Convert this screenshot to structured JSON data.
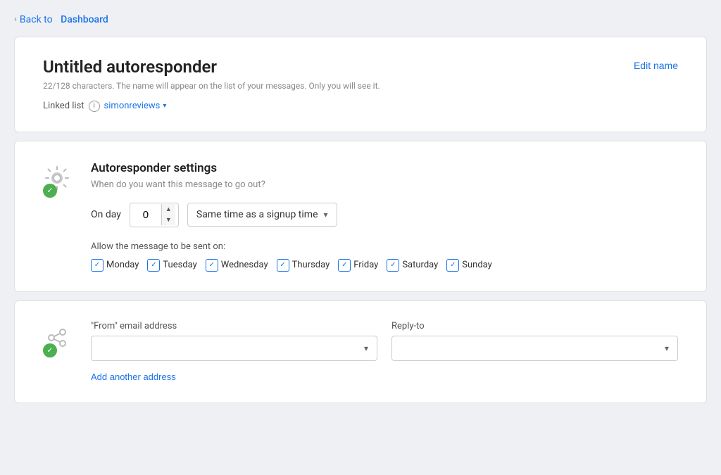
{
  "nav": {
    "chevron": "‹",
    "back_text": "Back to",
    "dashboard_text": "Dashboard"
  },
  "card1": {
    "title": "Untitled autoresponder",
    "char_count": "22/128 characters. The name will appear on the list of your messages. Only you will see it.",
    "linked_list_label": "Linked list",
    "linked_list_value": "simonreviews",
    "edit_name_label": "Edit name"
  },
  "card2": {
    "section_title": "Autoresponder settings",
    "section_subtitle": "When do you want this message to go out?",
    "day_label": "On day",
    "day_value": "0",
    "time_label": "Same time as a signup time",
    "allow_message_label": "Allow the message to be sent on:",
    "days": [
      {
        "name": "Monday",
        "checked": true
      },
      {
        "name": "Tuesday",
        "checked": true
      },
      {
        "name": "Wednesday",
        "checked": true
      },
      {
        "name": "Thursday",
        "checked": true
      },
      {
        "name": "Friday",
        "checked": true
      },
      {
        "name": "Saturday",
        "checked": true
      },
      {
        "name": "Sunday",
        "checked": true
      }
    ]
  },
  "card3": {
    "from_label": "\"From\" email address",
    "reply_to_label": "Reply-to",
    "add_address_label": "Add another address",
    "from_placeholder": "",
    "reply_placeholder": ""
  },
  "icons": {
    "gear": "⚙",
    "check": "✓",
    "arrow_share": "↗",
    "info": "i",
    "chevron_down": "▾",
    "spin_up": "▲",
    "spin_down": "▼"
  }
}
